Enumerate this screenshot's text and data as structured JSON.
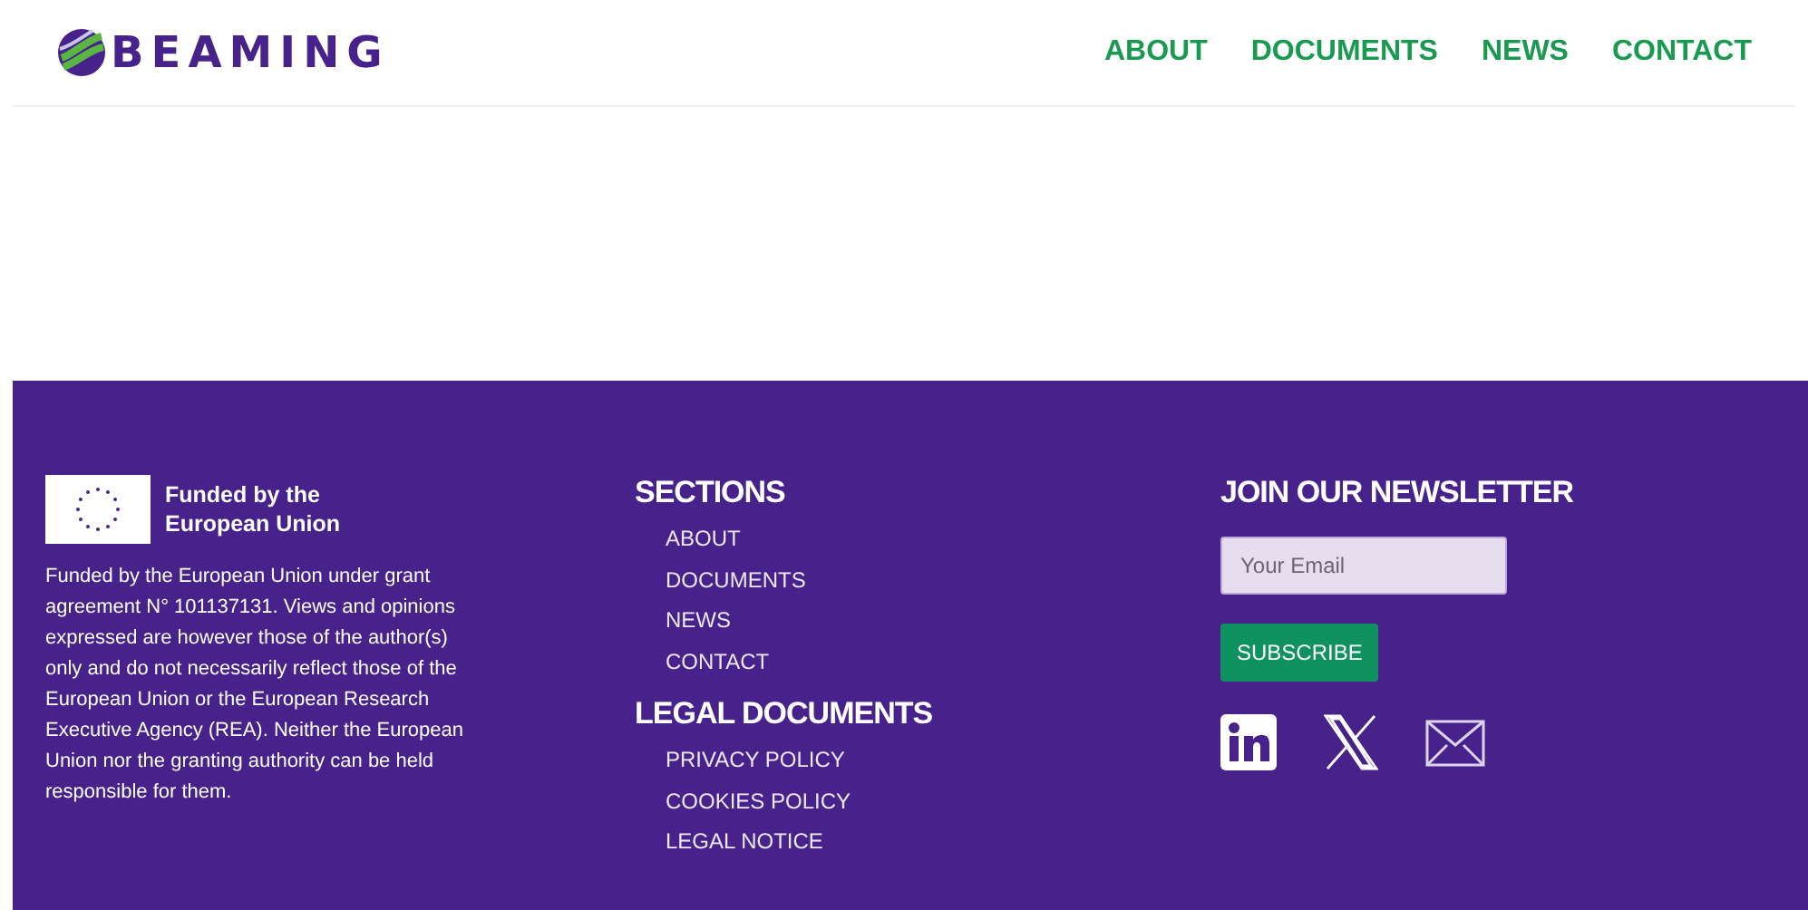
{
  "header": {
    "logo": "BEAMING",
    "nav": [
      {
        "label": "ABOUT"
      },
      {
        "label": "DOCUMENTS"
      },
      {
        "label": "NEWS"
      },
      {
        "label": "CONTACT"
      }
    ]
  },
  "footer": {
    "funding": {
      "title": "Funded by the European Union",
      "text": "Funded by the European Union under grant agreement N° 101137131. Views and opinions expressed are however those of the author(s) only and do not necessarily reflect those of the European Union or the European Research Executive Agency (REA). Neither the European Union nor the granting authority can be held responsible for them."
    },
    "sections": {
      "title": "SECTIONS",
      "links": [
        "ABOUT",
        "DOCUMENTS",
        "NEWS",
        "CONTACT"
      ]
    },
    "legal": {
      "title": "LEGAL DOCUMENTS",
      "links": [
        "PRIVACY POLICY",
        "COOKIES POLICY",
        "LEGAL NOTICE"
      ]
    },
    "newsletter": {
      "title": "JOIN OUR NEWSLETTER",
      "email": {
        "placeholder": "Your Email"
      },
      "button": "SUBSCRIBE",
      "social": [
        {
          "kind": "linkedin"
        },
        {
          "kind": "x"
        },
        {
          "kind": "mail"
        }
      ]
    }
  }
}
